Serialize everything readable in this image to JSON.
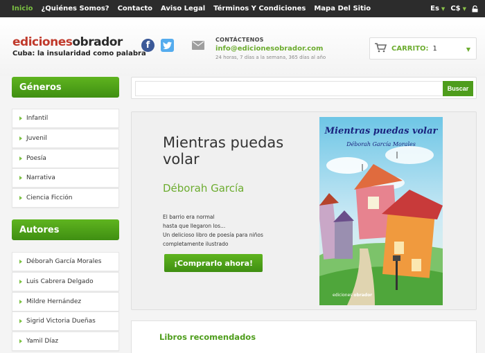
{
  "topbar": {
    "nav": [
      {
        "label": "Inicio",
        "active": true
      },
      {
        "label": "¿Quiénes Somos?",
        "active": false
      },
      {
        "label": "Contacto",
        "active": false
      },
      {
        "label": "Aviso Legal",
        "active": false
      },
      {
        "label": "Términos Y Condiciones",
        "active": false
      },
      {
        "label": "Mapa Del Sitio",
        "active": false
      }
    ],
    "language": "Es",
    "currency": "C$"
  },
  "header": {
    "logo": {
      "part1": "ediciones",
      "part2": "obrador",
      "tagline": "Cuba: la insularidad como palabra"
    },
    "contact": {
      "label": "CONTÁCTENOS",
      "email": "info@edicionesobrador.com",
      "hours": "24 horas, 7 días a la semana, 365 días al año"
    },
    "cart": {
      "label": "CARRITO:",
      "count": "1"
    }
  },
  "search": {
    "placeholder": "",
    "button": "Buscar"
  },
  "sidebar": {
    "generos": {
      "title": "Géneros",
      "items": [
        "Infantil",
        "Juvenil",
        "Poesía",
        "Narrativa",
        "Ciencia Ficción"
      ]
    },
    "autores": {
      "title": "Autores",
      "items": [
        "Déborah García Morales",
        "Luis Cabrera Delgado",
        "Mildre Hernández",
        "Sigrid Victoria Dueñas",
        "Yamil Díaz"
      ]
    }
  },
  "feature": {
    "title": "Mientras puedas volar",
    "author": "Déborah García",
    "description": [
      "El barrio era normal",
      "hasta que llegaron los...",
      "Un delicioso libro de poesía para niños",
      "completamente ilustrado"
    ],
    "button": "¡Comprarlo ahora!",
    "cover": {
      "title": "Mientras puedas volar",
      "author": "Déborah García Morales",
      "publisher_a": "ediciones ",
      "publisher_b": "obrador"
    }
  },
  "recommended": {
    "title": "Libros recomendados"
  },
  "colors": {
    "accent": "#6cac2f",
    "topbar": "#2c2c2c",
    "logo_red": "#c0392b"
  }
}
